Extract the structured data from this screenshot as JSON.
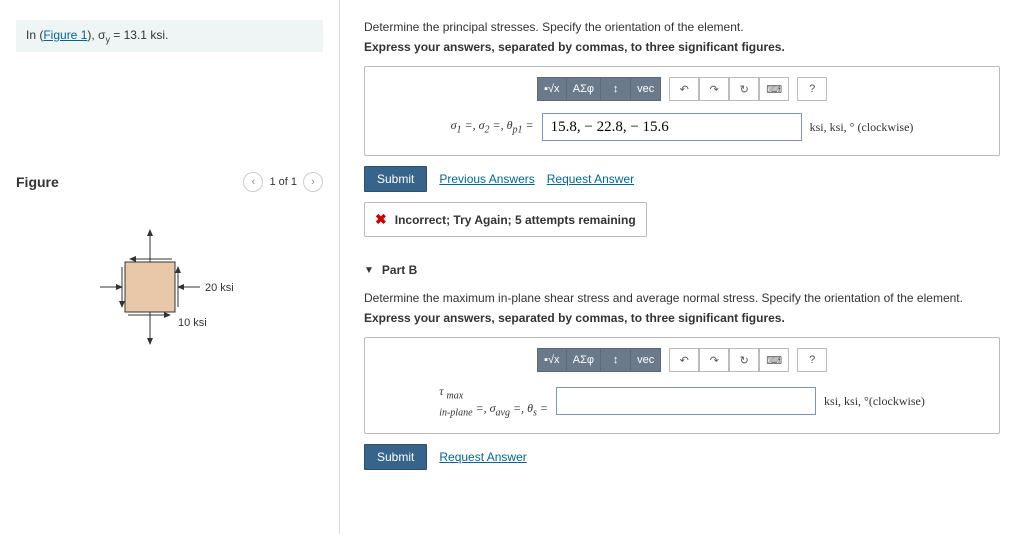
{
  "given": {
    "prefix": "In (",
    "link": "Figure 1",
    "suffix": "), σ",
    "sub": "y",
    "eq": " = 13.1 ksi."
  },
  "figure": {
    "title": "Figure",
    "pager": "1 of 1",
    "label_20": "20 ksi",
    "label_10": "10 ksi"
  },
  "partA": {
    "prompt": "Determine the principal stresses. Specify the orientation of the element.",
    "instruction": "Express your answers, separated by commas, to three significant figures.",
    "toolbar": {
      "sqrt": "√x",
      "greek": "ΑΣφ",
      "super": "↕",
      "vec": "vec",
      "undo": "↶",
      "redo": "↷",
      "reset": "↻",
      "kbd": "⌨",
      "help": "?"
    },
    "label_html": "σ₁ =, σ₂ =, θₚ₁ =",
    "value": "15.8, − 22.8, − 15.6",
    "units": "ksi, ksi, ° (clockwise)",
    "submit": "Submit",
    "prev": "Previous Answers",
    "request": "Request Answer",
    "feedback": "Incorrect; Try Again; 5 attempts remaining"
  },
  "partB": {
    "header": "Part B",
    "prompt": "Determine the maximum in-plane shear stress and average normal stress. Specify the orientation of the element.",
    "instruction": "Express your answers, separated by commas, to three significant figures.",
    "toolbar": {
      "sqrt": "√x",
      "greek": "ΑΣφ",
      "super": "↕",
      "vec": "vec",
      "undo": "↶",
      "redo": "↷",
      "reset": "↻",
      "kbd": "⌨",
      "help": "?"
    },
    "label_html": "τ max in-plane =, σavg =, θs =",
    "value": "",
    "units": "ksi, ksi, °(clockwise)",
    "submit": "Submit",
    "request": "Request Answer"
  }
}
